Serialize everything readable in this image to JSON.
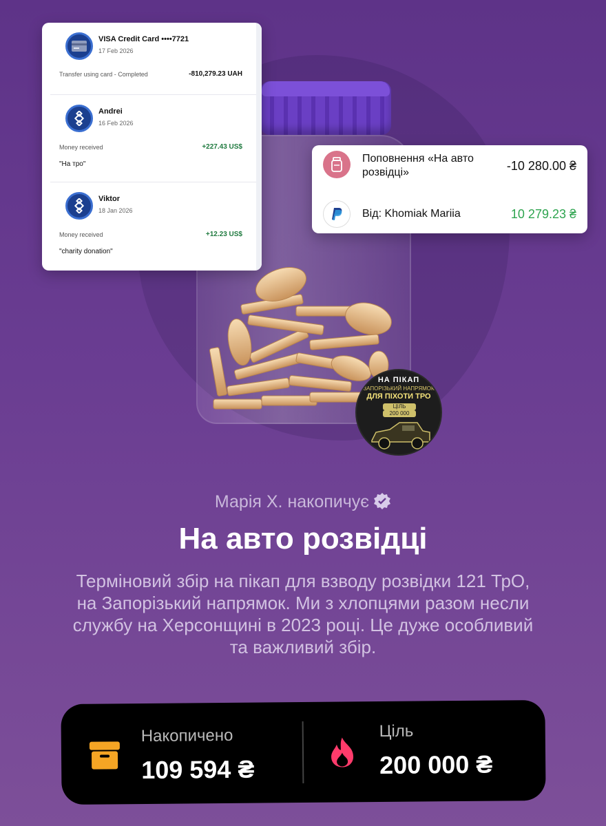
{
  "left_card": {
    "transactions": [
      {
        "name": "VISA Credit Card ••••7721",
        "date": "17 Feb 2026",
        "description": "Transfer using card - Completed",
        "amount": "-810,279.23 UAH",
        "amount_color": "#111111",
        "note": ""
      },
      {
        "name": "Andrei",
        "date": "16 Feb 2026",
        "description": "Money received",
        "amount": "+227.43 US$",
        "amount_color": "#1f7a3f",
        "note": "\"На тро\""
      },
      {
        "name": "Viktor",
        "date": "18 Jan 2026",
        "description": "Money received",
        "amount": "+12.23 US$",
        "amount_color": "#1f7a3f",
        "note": "\"charity donation\""
      }
    ]
  },
  "right_card": {
    "row1": {
      "label": "Поповнення «На авто розвідці»",
      "amount": "-10 280.00 ₴",
      "icon": "jar-icon"
    },
    "row2": {
      "label": "Від: Khomiak Mariia",
      "amount": "10 279.23 ₴",
      "icon": "paypal-icon"
    }
  },
  "badge": {
    "line1": "НА ПІКАП",
    "line2": "ЗАПОРІЗЬКИЙ НАПРЯМОК",
    "line3": "ДЛЯ ПІХОТИ ТРО",
    "line4": "ЦІЛЬ",
    "line5": "200 000"
  },
  "jar": {
    "owner_line": "Марія Х. накопичує",
    "title": "На авто розвідці",
    "description": "Терміновий збір на пікап для взводу розвідки 121 ТрО, на Запорізький напрямок. Ми з хлопцями разом несли службу на Херсонщині в 2023 році. Це дуже особливий та важливий збір."
  },
  "stats": {
    "accumulated_label": "Накопичено",
    "accumulated_value": "109 594 ₴",
    "goal_label": "Ціль",
    "goal_value": "200 000 ₴"
  },
  "colors": {
    "positive": "#2ea44f",
    "accent_orange": "#f5a524",
    "accent_pink": "#ff3b6b",
    "verified": "#d8ccea"
  }
}
